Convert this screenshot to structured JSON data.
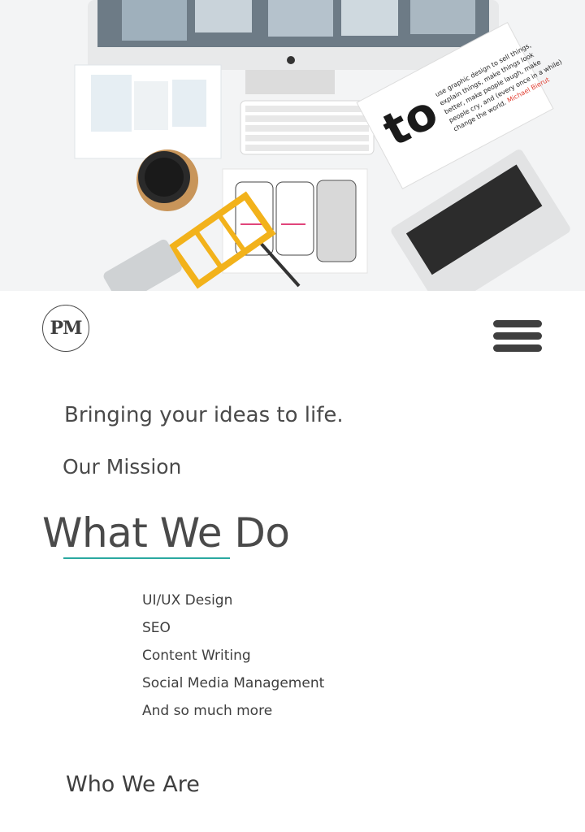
{
  "hero": {
    "book_text": "to",
    "book_blurb": "use graphic design to sell things, explain things, make things look better, make people laugh, make people cry, and (every once in a while) change the world.",
    "book_author": "Michael Bierut"
  },
  "header": {
    "logo_text": "PM",
    "menu_icon": "hamburger-menu-icon"
  },
  "main": {
    "tagline": "Bringing your ideas to life.",
    "mission_link": "Our Mission",
    "section_title": "What We Do",
    "services": [
      "UI/UX Design",
      "SEO",
      "Content Writing",
      "Social Media Management",
      "And so much more"
    ],
    "who_link": "Who We Are"
  },
  "colors": {
    "accent": "#2aa8a0",
    "text": "#4a4a4a"
  }
}
